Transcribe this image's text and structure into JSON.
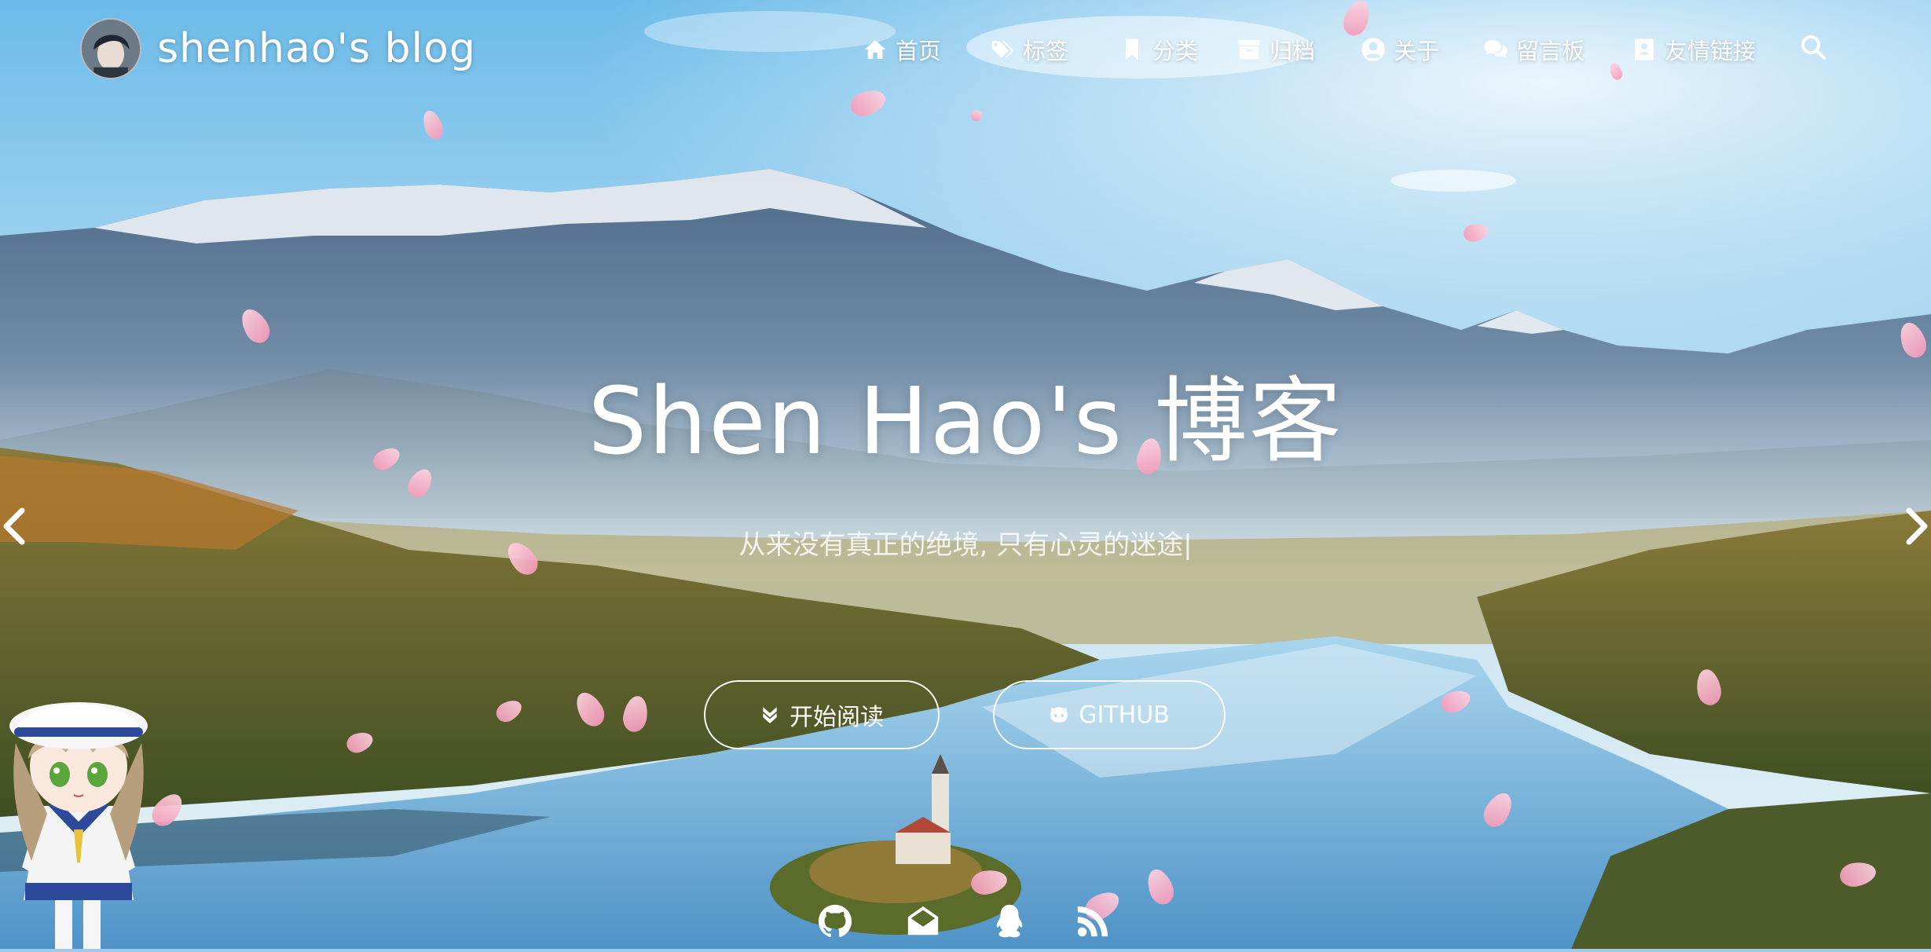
{
  "site": {
    "brand_name": "shenhao's blog",
    "avatar_icon": "avatar-icon"
  },
  "nav": {
    "items": [
      {
        "label": "首页",
        "icon": "home-icon"
      },
      {
        "label": "标签",
        "icon": "tags-icon"
      },
      {
        "label": "分类",
        "icon": "bookmark-icon"
      },
      {
        "label": "归档",
        "icon": "archive-icon"
      },
      {
        "label": "关于",
        "icon": "user-circle-icon"
      },
      {
        "label": "留言板",
        "icon": "comments-icon"
      },
      {
        "label": "友情链接",
        "icon": "address-book-icon"
      }
    ],
    "search_icon": "search-icon"
  },
  "hero": {
    "title": "Shen Hao's 博客",
    "subtitle": "从来没有真正的绝境, 只有心灵的迷途|"
  },
  "buttons": {
    "read_label": "开始阅读",
    "read_icon": "chevron-double-down-icon",
    "github_label": "GITHUB",
    "github_icon": "github-cat-icon"
  },
  "social": [
    "github-icon",
    "mail-icon",
    "qq-icon",
    "rss-icon"
  ],
  "colors": {
    "sky_top": "#7ec4ee",
    "petal": "#f497b6",
    "text": "#ffffff"
  }
}
